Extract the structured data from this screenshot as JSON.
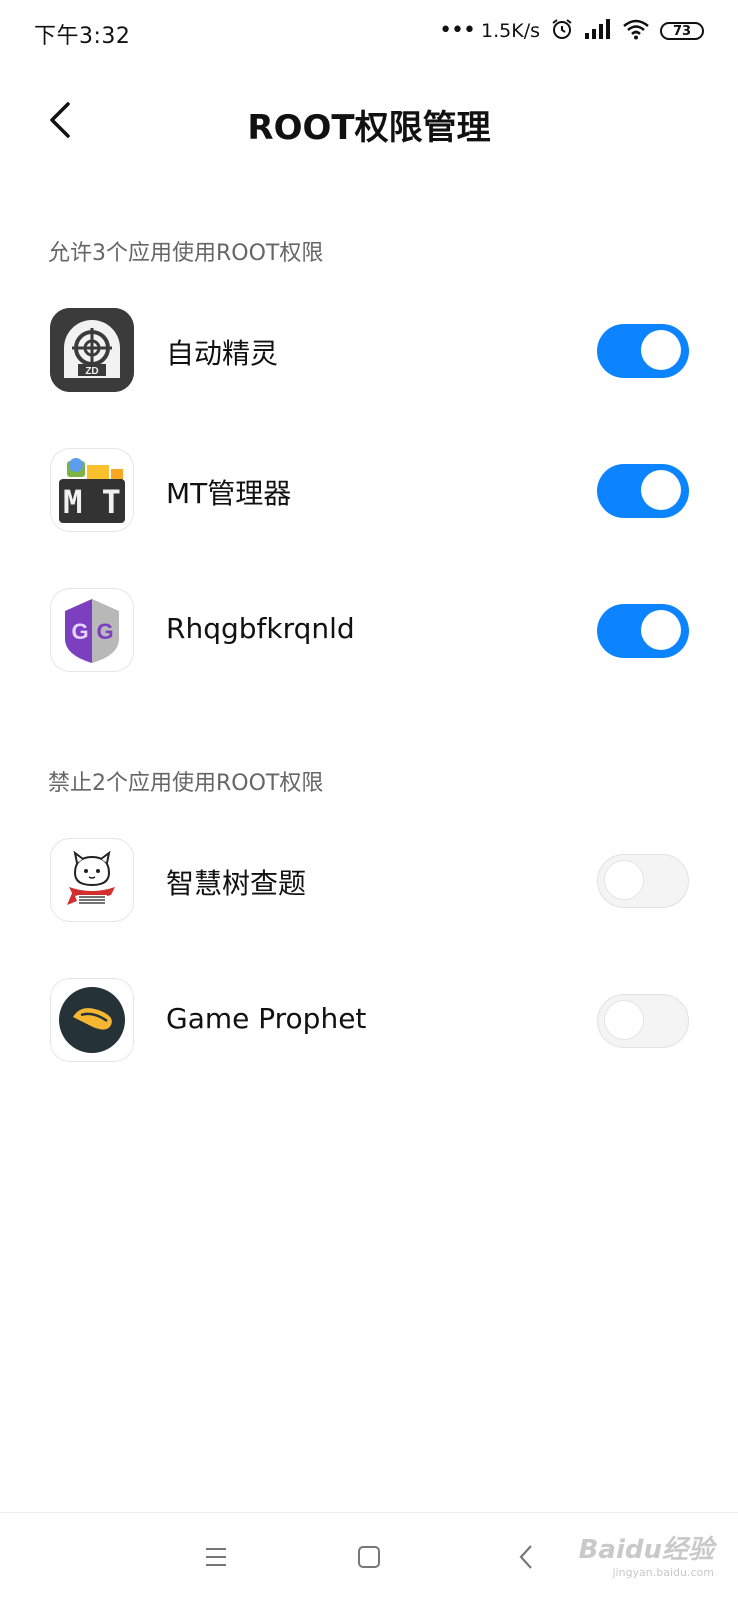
{
  "status_bar": {
    "time": "下午3:32",
    "network_speed": "1.5K/s",
    "battery_level": "73",
    "icons": [
      "more-dots-icon",
      "alarm-icon",
      "signal-icon",
      "wifi-icon",
      "battery-icon"
    ]
  },
  "header": {
    "title": "ROOT权限管理",
    "back_icon": "back-chevron-icon"
  },
  "allowed_section": {
    "label": "允许3个应用使用ROOT权限",
    "apps": [
      {
        "name": "自动精灵",
        "enabled": true,
        "icon": "zd-app-icon"
      },
      {
        "name": "MT管理器",
        "enabled": true,
        "icon": "mt-manager-icon"
      },
      {
        "name": "Rhqgbfkrqnld",
        "enabled": true,
        "icon": "gg-app-icon"
      }
    ]
  },
  "denied_section": {
    "label": "禁止2个应用使用ROOT权限",
    "apps": [
      {
        "name": "智慧树查题",
        "enabled": false,
        "icon": "cat-app-icon"
      },
      {
        "name": "Game Prophet",
        "enabled": false,
        "icon": "game-prophet-icon"
      }
    ]
  },
  "nav_bar": {
    "icons": [
      "menu-icon",
      "home-icon",
      "back-icon"
    ]
  },
  "watermark": {
    "text": "Baidu经验",
    "subtext": "jingyan.baidu.com"
  },
  "colors": {
    "toggle_on": "#0d84ff",
    "toggle_off": "#f4f4f4",
    "section_label": "#666666"
  }
}
